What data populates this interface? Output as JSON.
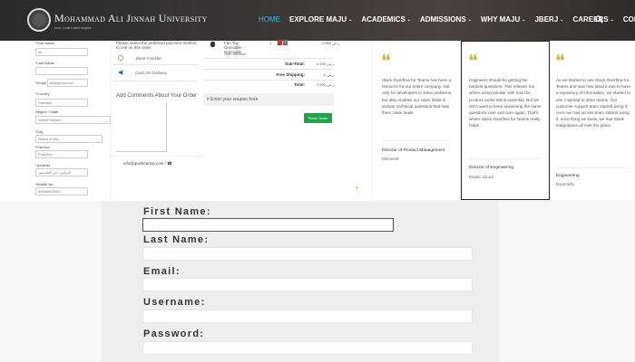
{
  "header": {
    "university_name": "Mohammad Ali Jinnah University",
    "tagline": "Live, Learn and Inspire",
    "nav": [
      {
        "label": "HOME",
        "dropdown": false,
        "active": true
      },
      {
        "label": "EXPLORE MAJU",
        "dropdown": true,
        "active": false
      },
      {
        "label": "ACADEMICS",
        "dropdown": true,
        "active": false
      },
      {
        "label": "ADMISSIONS",
        "dropdown": true,
        "active": false
      },
      {
        "label": "WHY MAJU",
        "dropdown": true,
        "active": false
      },
      {
        "label": "JBERJ",
        "dropdown": true,
        "active": false
      },
      {
        "label": "CAREERS",
        "dropdown": true,
        "active": false
      },
      {
        "label": "CONTACT",
        "dropdown": false,
        "active": false
      }
    ],
    "caret": "⌄"
  },
  "checkout": {
    "first_name_label": "*First Name",
    "first_name_value": "ali",
    "last_name_label": "*Last Name",
    "email_label": "*Email",
    "email_value": "ali@gmail.com",
    "country_label": "*Country",
    "country_value": "Pakistan",
    "region_label": "Region / State",
    "region_value": "Select Region",
    "city_label": "*City",
    "city_value": "Select a City",
    "post_box_label": "Post Box",
    "post_box_value": "Post Box",
    "address_label": "*Address",
    "address_value": "الرياض، حي الياسمين",
    "mobile_label": "*Mobile No.",
    "mobile_value": "00966000000",
    "payment_hint": "Please select the preferred payment method to use on this order.",
    "payment_options": [
      "Bank Transfer",
      "Cash On Delivery"
    ],
    "comment_label": "Add Comments About Your Order",
    "contact_text": "info@quickcartsa.com / ☎",
    "product_name": "Fun Toy Crocodile - Crocodile",
    "product_size": "Size: Medium",
    "qty": "1",
    "minus": "−",
    "plus": "+",
    "product_price": "ر.س 2.900",
    "summary": [
      {
        "label": "Sub-Total:",
        "value": "ر.س 2.900"
      },
      {
        "label": "Free Shipping:",
        "value": "ر.س 0"
      },
      {
        "label": "Total:",
        "value": "ر.س 2.900"
      }
    ],
    "coupon_placeholder": "Enter your coupon here",
    "place_order": "Place Order"
  },
  "testimonials": [
    {
      "text": "Stack Overflow for Teams has been a resource for our entire company. Not only for developers to solve problems, but also enables our sales fields to answer technical questions that help them close deals.",
      "role": "Director of Product Management",
      "company": "Microsoft"
    },
    {
      "text": "Engineers should be getting the hardest questions. This relieves me, where using familiar with how the product works still is essential. But we don't want to keep answering the same questions over and over again. That's where Stack Overflow for Teams really helps.",
      "role": "Director of Engineering",
      "company": "Elastic Cloud"
    },
    {
      "text": "As we started to use Stack Overflow for Teams and saw how ideal it was to have a repository of information, we started to see it spread to other teams. Our customer support team started using it, once we had access team started using it, once thing we knew, we had Slack integrations all over the place.",
      "role": "Engineering",
      "company": "Expensify"
    }
  ],
  "registration": {
    "first_name_label": "First Name:",
    "last_name_label": "Last Name:",
    "email_label": "Email:",
    "username_label": "Username:",
    "password_label": "Password:"
  },
  "colors": {
    "accent": "#2fb6e8",
    "gold": "#c9b64e",
    "order_green": "#1ea34a",
    "qty_red": "#cc2b2b"
  }
}
